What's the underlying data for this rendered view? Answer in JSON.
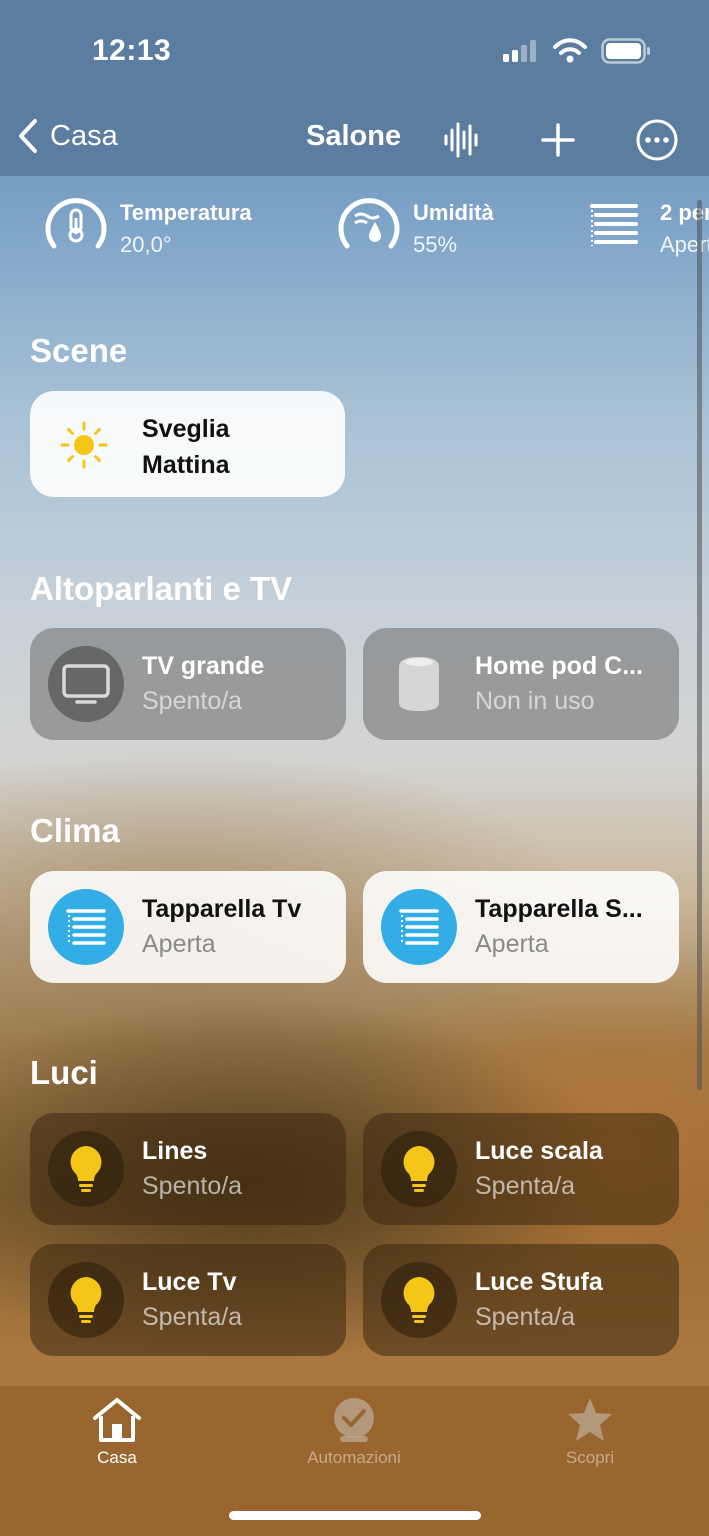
{
  "status_bar": {
    "time": "12:13"
  },
  "nav": {
    "back_label": "Casa",
    "title": "Salone",
    "icons": [
      "waveform-icon",
      "plus-icon",
      "ellipsis-circle-icon"
    ]
  },
  "sensors": [
    {
      "label": "Temperatura",
      "value": "20,0°",
      "icon": "thermometer-icon"
    },
    {
      "label": "Umidità",
      "value": "55%",
      "icon": "humidity-icon"
    },
    {
      "label": "2 per",
      "value": "Apert",
      "icon": "blinds-icon"
    }
  ],
  "sections": {
    "scene": {
      "title": "Scene",
      "items": [
        {
          "name": "Sveglia Mattina",
          "icon": "sun-icon"
        }
      ]
    },
    "speakers": {
      "title": "Altoparlanti e TV",
      "items": [
        {
          "name": "TV grande",
          "status": "Spento/a",
          "icon": "tv-icon"
        },
        {
          "name": "Home pod C...",
          "status": "Non in uso",
          "icon": "homepod-icon"
        }
      ]
    },
    "clima": {
      "title": "Clima",
      "items": [
        {
          "name": "Tapparella Tv",
          "status": "Aperta",
          "icon": "blinds-icon",
          "accent": "#32ade6"
        },
        {
          "name": "Tapparella S...",
          "status": "Aperta",
          "icon": "blinds-icon",
          "accent": "#32ade6"
        }
      ]
    },
    "luci": {
      "title": "Luci",
      "items": [
        {
          "name": "Lines",
          "status": "Spento/a",
          "icon": "lightbulb-icon",
          "accent": "#f5c518"
        },
        {
          "name": "Luce scala",
          "status": "Spenta/a",
          "icon": "lightbulb-icon",
          "accent": "#f5c518"
        },
        {
          "name": "Luce Tv",
          "status": "Spenta/a",
          "icon": "lightbulb-icon",
          "accent": "#f5c518"
        },
        {
          "name": "Luce Stufa",
          "status": "Spenta/a",
          "icon": "lightbulb-icon",
          "accent": "#f5c518"
        }
      ]
    }
  },
  "tab_bar": {
    "tabs": [
      {
        "label": "Casa",
        "icon": "house-icon",
        "active": true
      },
      {
        "label": "Automazioni",
        "icon": "clock-check-icon",
        "active": false
      },
      {
        "label": "Scopri",
        "icon": "star-icon",
        "active": false
      }
    ]
  }
}
